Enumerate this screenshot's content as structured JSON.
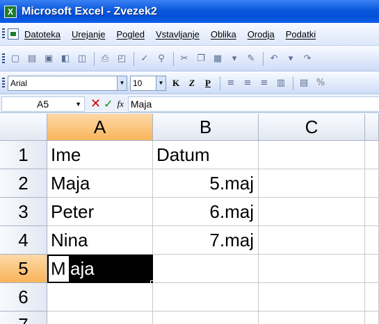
{
  "window": {
    "title": "Microsoft Excel - Zvezek2"
  },
  "menu": [
    "Datoteka",
    "Urejanje",
    "Pogled",
    "Vstavljanje",
    "Oblika",
    "Orodja",
    "Podatki"
  ],
  "format_toolbar": {
    "font": "Arial",
    "font_size": "10",
    "bold": "K",
    "italic": "Z",
    "underline": "P",
    "percent": "%"
  },
  "formula_bar": {
    "name_box": "A5",
    "fx": "fx",
    "content": "Maja"
  },
  "columns": [
    "A",
    "B",
    "C"
  ],
  "rows": [
    {
      "num": "1",
      "a": "Ime",
      "b": "Datum"
    },
    {
      "num": "2",
      "a": "Maja",
      "b": "5.maj"
    },
    {
      "num": "3",
      "a": "Peter",
      "b": "6.maj"
    },
    {
      "num": "4",
      "a": "Nina",
      "b": "7.maj"
    },
    {
      "num": "5",
      "a": "M",
      "a_selected": "aja",
      "b": ""
    },
    {
      "num": "6",
      "a": "",
      "b": ""
    },
    {
      "num": "7",
      "a": "",
      "b": ""
    }
  ],
  "colors": {
    "title_bar": "#0a58dc",
    "selection_header": "#f9b45c"
  }
}
